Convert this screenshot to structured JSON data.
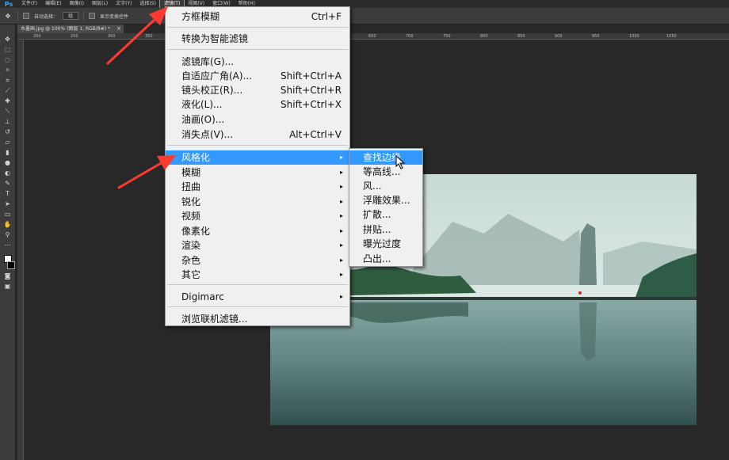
{
  "app": {
    "logo": "Ps",
    "menubar": [
      "文件(F)",
      "编辑(E)",
      "图像(I)",
      "图层(L)",
      "文字(Y)",
      "选择(S)",
      "滤镜(T)",
      "视图(V)",
      "窗口(W)",
      "帮助(H)"
    ],
    "active_menu_index": 6
  },
  "options": {
    "auto_select_label": "自动选择：",
    "auto_select_value": "组",
    "show_transform_label": "显示变换控件"
  },
  "document": {
    "tab_title": "水墨画.jpg @ 100% (图层 1, RGB/8#) *",
    "close_glyph": "×"
  },
  "ruler": {
    "ticks": [
      "200",
      "250",
      "300",
      "350",
      "400",
      "450",
      "500",
      "550",
      "600",
      "650",
      "700",
      "750",
      "800",
      "850",
      "900",
      "950",
      "1000",
      "1050"
    ]
  },
  "filter_menu": {
    "last_filter": {
      "label": "方框模糊",
      "shortcut": "Ctrl+F"
    },
    "smart_filter": "转换为智能滤镜",
    "group1": [
      {
        "label": "滤镜库(G)...",
        "shortcut": ""
      },
      {
        "label": "自适应广角(A)...",
        "shortcut": "Shift+Ctrl+A"
      },
      {
        "label": "镜头校正(R)...",
        "shortcut": "Shift+Ctrl+R"
      },
      {
        "label": "液化(L)...",
        "shortcut": "Shift+Ctrl+X"
      },
      {
        "label": "油画(O)...",
        "shortcut": ""
      },
      {
        "label": "消失点(V)...",
        "shortcut": "Alt+Ctrl+V"
      }
    ],
    "submenus": [
      "风格化",
      "模糊",
      "扭曲",
      "锐化",
      "视频",
      "像素化",
      "渲染",
      "杂色",
      "其它"
    ],
    "highlighted_index": 0,
    "digimarc": "Digimarc",
    "browse_online": "浏览联机滤镜...",
    "arrow_glyph": "▸"
  },
  "stylize_menu": {
    "items": [
      "查找边缘",
      "等高线...",
      "风...",
      "浮雕效果...",
      "扩散...",
      "拼贴...",
      "曝光过度",
      "凸出..."
    ],
    "highlighted_index": 0
  },
  "colors": {
    "highlight": "#3399ff",
    "annotation_arrow": "#ff3b30",
    "workspace": "#282828"
  }
}
